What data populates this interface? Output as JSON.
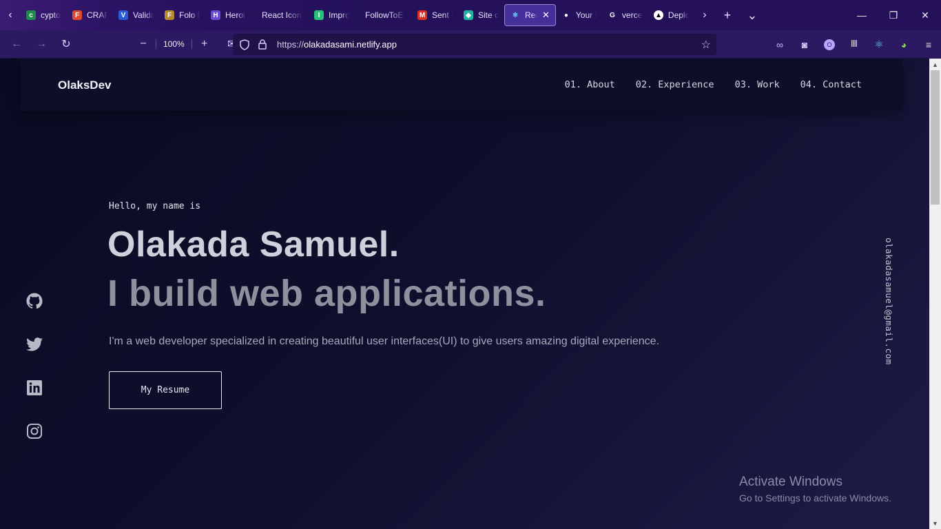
{
  "tabs": [
    {
      "title": "cypto",
      "color": "#1f8a4c",
      "glyph": "c"
    },
    {
      "title": "CRAP",
      "color": "#e04a2f",
      "glyph": "F"
    },
    {
      "title": "Valida",
      "color": "#2b5bd7",
      "glyph": "V"
    },
    {
      "title": "Folo P",
      "color": "#b8872f",
      "glyph": "F"
    },
    {
      "title": "Heroi",
      "color": "#6a4bd4",
      "glyph": "H"
    },
    {
      "title": "React Icon",
      "color": "#24115a",
      "glyph": ""
    },
    {
      "title": "Impro",
      "color": "#28c07a",
      "glyph": "I"
    },
    {
      "title": "FollowToE",
      "color": "#24115a",
      "glyph": ""
    },
    {
      "title": "Sent N",
      "color": "#d93025",
      "glyph": "M"
    },
    {
      "title": "Site ov",
      "color": "#20b4a0",
      "glyph": "◆"
    },
    {
      "title": "Rea",
      "color": "#61dafb",
      "glyph": "⚛"
    },
    {
      "title": "Your R",
      "color": "#ffffff",
      "glyph": "●"
    },
    {
      "title": "vercel",
      "color": "#ffffff",
      "glyph": "G"
    },
    {
      "title": "Deplo",
      "color": "#000000",
      "glyph": "▲"
    }
  ],
  "active_tab_index": 10,
  "toolbar": {
    "zoom": "100%",
    "url_prefix": "https://",
    "url_host": "olakadasami.netlify.app"
  },
  "site": {
    "logo": "OlaksDev",
    "menu": [
      "01. About",
      "02. Experience",
      "03. Work",
      "04. Contact"
    ],
    "hello": "Hello, my name is",
    "name": "Olakada Samuel.",
    "tagline": "I build web applications.",
    "description": "I'm a web developer specialized in creating beautiful user interfaces(UI) to give users amazing digital experience.",
    "resume_label": "My Resume",
    "email": "olakadasamuel@gmail.com",
    "socials": [
      "github-icon",
      "twitter-icon",
      "linkedin-icon",
      "instagram-icon"
    ]
  },
  "watermark": {
    "title": "Activate Windows",
    "subtitle": "Go to Settings to activate Windows."
  },
  "colors": {
    "page_bg": "#0b0c24",
    "tab_bg": "#24115a",
    "accent": "#cfd0dc"
  }
}
